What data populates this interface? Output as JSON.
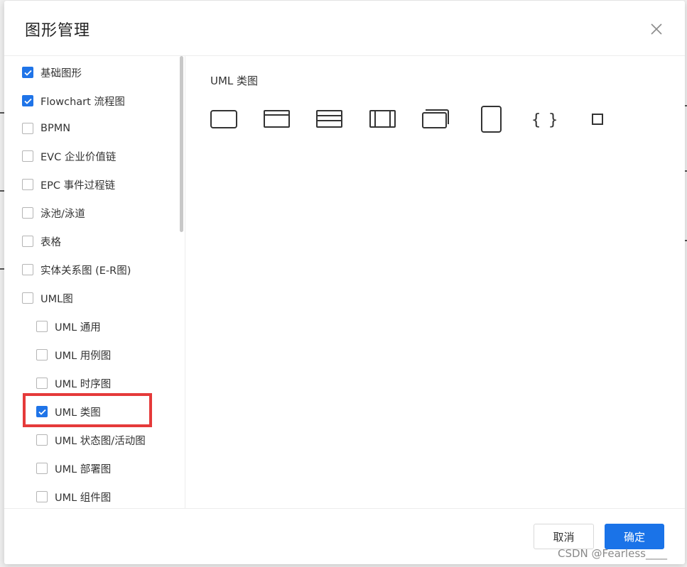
{
  "dialog": {
    "title": "图形管理",
    "close_icon": "close-icon"
  },
  "categories": [
    {
      "label": "基础图形",
      "checked": true
    },
    {
      "label": "Flowchart 流程图",
      "checked": true
    },
    {
      "label": "BPMN",
      "checked": false
    },
    {
      "label": "EVC 企业价值链",
      "checked": false
    },
    {
      "label": "EPC 事件过程链",
      "checked": false
    },
    {
      "label": "泳池/泳道",
      "checked": false
    },
    {
      "label": "表格",
      "checked": false
    },
    {
      "label": "实体关系图 (E-R图)",
      "checked": false
    },
    {
      "label": "UML图",
      "checked": false
    },
    {
      "label": "UML 通用",
      "checked": false
    },
    {
      "label": "UML 用例图",
      "checked": false
    },
    {
      "label": "UML 时序图",
      "checked": false
    },
    {
      "label": "UML 类图",
      "checked": true
    },
    {
      "label": "UML 状态图/活动图",
      "checked": false
    },
    {
      "label": "UML 部署图",
      "checked": false
    },
    {
      "label": "UML 组件图",
      "checked": false
    }
  ],
  "preview": {
    "section_title": "UML 类图",
    "shapes": [
      "class-box-icon",
      "class-header-icon",
      "class-three-row-icon",
      "class-columns-icon",
      "class-stacked-icon",
      "class-tall-icon",
      "braces-icon",
      "small-square-icon"
    ]
  },
  "footer": {
    "cancel_label": "取消",
    "ok_label": "确定"
  },
  "watermark": "CSDN @Fearless____",
  "colors": {
    "accent": "#1a73e8",
    "highlight": "#e53a3a"
  }
}
